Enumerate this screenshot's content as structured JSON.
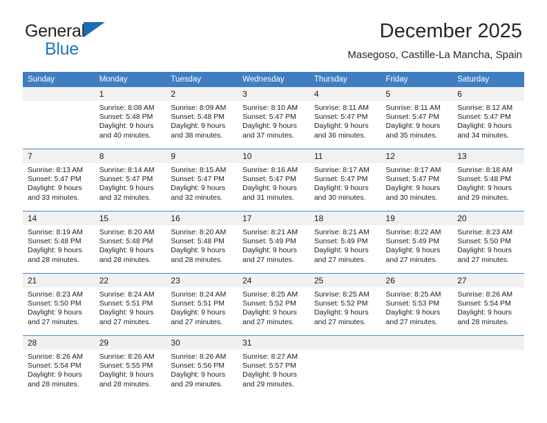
{
  "brand": {
    "name_part1": "General",
    "name_part2": "Blue",
    "triangle_color": "#1b6cb3",
    "text_color": "#231f20",
    "blue_color": "#1b75bb"
  },
  "header": {
    "title": "December 2025",
    "subtitle": "Masegoso, Castille-La Mancha, Spain"
  },
  "theme": {
    "header_bg": "#3f7fc1",
    "daynum_bg": "#f1f1f1",
    "row_divider": "#4a86c5"
  },
  "weekdays": [
    "Sunday",
    "Monday",
    "Tuesday",
    "Wednesday",
    "Thursday",
    "Friday",
    "Saturday"
  ],
  "labels": {
    "sunrise_prefix": "Sunrise:",
    "sunset_prefix": "Sunset:",
    "daylight_prefix": "Daylight:"
  },
  "weeks": [
    [
      {
        "day": "",
        "empty": true,
        "sunrise": "",
        "sunset": "",
        "daylight_line1": "",
        "daylight_line2": ""
      },
      {
        "day": "1",
        "sunrise": "Sunrise: 8:08 AM",
        "sunset": "Sunset: 5:48 PM",
        "daylight_line1": "Daylight: 9 hours",
        "daylight_line2": "and 40 minutes."
      },
      {
        "day": "2",
        "sunrise": "Sunrise: 8:09 AM",
        "sunset": "Sunset: 5:48 PM",
        "daylight_line1": "Daylight: 9 hours",
        "daylight_line2": "and 38 minutes."
      },
      {
        "day": "3",
        "sunrise": "Sunrise: 8:10 AM",
        "sunset": "Sunset: 5:47 PM",
        "daylight_line1": "Daylight: 9 hours",
        "daylight_line2": "and 37 minutes."
      },
      {
        "day": "4",
        "sunrise": "Sunrise: 8:11 AM",
        "sunset": "Sunset: 5:47 PM",
        "daylight_line1": "Daylight: 9 hours",
        "daylight_line2": "and 36 minutes."
      },
      {
        "day": "5",
        "sunrise": "Sunrise: 8:11 AM",
        "sunset": "Sunset: 5:47 PM",
        "daylight_line1": "Daylight: 9 hours",
        "daylight_line2": "and 35 minutes."
      },
      {
        "day": "6",
        "sunrise": "Sunrise: 8:12 AM",
        "sunset": "Sunset: 5:47 PM",
        "daylight_line1": "Daylight: 9 hours",
        "daylight_line2": "and 34 minutes."
      }
    ],
    [
      {
        "day": "7",
        "sunrise": "Sunrise: 8:13 AM",
        "sunset": "Sunset: 5:47 PM",
        "daylight_line1": "Daylight: 9 hours",
        "daylight_line2": "and 33 minutes."
      },
      {
        "day": "8",
        "sunrise": "Sunrise: 8:14 AM",
        "sunset": "Sunset: 5:47 PM",
        "daylight_line1": "Daylight: 9 hours",
        "daylight_line2": "and 32 minutes."
      },
      {
        "day": "9",
        "sunrise": "Sunrise: 8:15 AM",
        "sunset": "Sunset: 5:47 PM",
        "daylight_line1": "Daylight: 9 hours",
        "daylight_line2": "and 32 minutes."
      },
      {
        "day": "10",
        "sunrise": "Sunrise: 8:16 AM",
        "sunset": "Sunset: 5:47 PM",
        "daylight_line1": "Daylight: 9 hours",
        "daylight_line2": "and 31 minutes."
      },
      {
        "day": "11",
        "sunrise": "Sunrise: 8:17 AM",
        "sunset": "Sunset: 5:47 PM",
        "daylight_line1": "Daylight: 9 hours",
        "daylight_line2": "and 30 minutes."
      },
      {
        "day": "12",
        "sunrise": "Sunrise: 8:17 AM",
        "sunset": "Sunset: 5:47 PM",
        "daylight_line1": "Daylight: 9 hours",
        "daylight_line2": "and 30 minutes."
      },
      {
        "day": "13",
        "sunrise": "Sunrise: 8:18 AM",
        "sunset": "Sunset: 5:48 PM",
        "daylight_line1": "Daylight: 9 hours",
        "daylight_line2": "and 29 minutes."
      }
    ],
    [
      {
        "day": "14",
        "sunrise": "Sunrise: 8:19 AM",
        "sunset": "Sunset: 5:48 PM",
        "daylight_line1": "Daylight: 9 hours",
        "daylight_line2": "and 28 minutes."
      },
      {
        "day": "15",
        "sunrise": "Sunrise: 8:20 AM",
        "sunset": "Sunset: 5:48 PM",
        "daylight_line1": "Daylight: 9 hours",
        "daylight_line2": "and 28 minutes."
      },
      {
        "day": "16",
        "sunrise": "Sunrise: 8:20 AM",
        "sunset": "Sunset: 5:48 PM",
        "daylight_line1": "Daylight: 9 hours",
        "daylight_line2": "and 28 minutes."
      },
      {
        "day": "17",
        "sunrise": "Sunrise: 8:21 AM",
        "sunset": "Sunset: 5:49 PM",
        "daylight_line1": "Daylight: 9 hours",
        "daylight_line2": "and 27 minutes."
      },
      {
        "day": "18",
        "sunrise": "Sunrise: 8:21 AM",
        "sunset": "Sunset: 5:49 PM",
        "daylight_line1": "Daylight: 9 hours",
        "daylight_line2": "and 27 minutes."
      },
      {
        "day": "19",
        "sunrise": "Sunrise: 8:22 AM",
        "sunset": "Sunset: 5:49 PM",
        "daylight_line1": "Daylight: 9 hours",
        "daylight_line2": "and 27 minutes."
      },
      {
        "day": "20",
        "sunrise": "Sunrise: 8:23 AM",
        "sunset": "Sunset: 5:50 PM",
        "daylight_line1": "Daylight: 9 hours",
        "daylight_line2": "and 27 minutes."
      }
    ],
    [
      {
        "day": "21",
        "sunrise": "Sunrise: 8:23 AM",
        "sunset": "Sunset: 5:50 PM",
        "daylight_line1": "Daylight: 9 hours",
        "daylight_line2": "and 27 minutes."
      },
      {
        "day": "22",
        "sunrise": "Sunrise: 8:24 AM",
        "sunset": "Sunset: 5:51 PM",
        "daylight_line1": "Daylight: 9 hours",
        "daylight_line2": "and 27 minutes."
      },
      {
        "day": "23",
        "sunrise": "Sunrise: 8:24 AM",
        "sunset": "Sunset: 5:51 PM",
        "daylight_line1": "Daylight: 9 hours",
        "daylight_line2": "and 27 minutes."
      },
      {
        "day": "24",
        "sunrise": "Sunrise: 8:25 AM",
        "sunset": "Sunset: 5:52 PM",
        "daylight_line1": "Daylight: 9 hours",
        "daylight_line2": "and 27 minutes."
      },
      {
        "day": "25",
        "sunrise": "Sunrise: 8:25 AM",
        "sunset": "Sunset: 5:52 PM",
        "daylight_line1": "Daylight: 9 hours",
        "daylight_line2": "and 27 minutes."
      },
      {
        "day": "26",
        "sunrise": "Sunrise: 8:25 AM",
        "sunset": "Sunset: 5:53 PM",
        "daylight_line1": "Daylight: 9 hours",
        "daylight_line2": "and 27 minutes."
      },
      {
        "day": "27",
        "sunrise": "Sunrise: 8:26 AM",
        "sunset": "Sunset: 5:54 PM",
        "daylight_line1": "Daylight: 9 hours",
        "daylight_line2": "and 28 minutes."
      }
    ],
    [
      {
        "day": "28",
        "sunrise": "Sunrise: 8:26 AM",
        "sunset": "Sunset: 5:54 PM",
        "daylight_line1": "Daylight: 9 hours",
        "daylight_line2": "and 28 minutes."
      },
      {
        "day": "29",
        "sunrise": "Sunrise: 8:26 AM",
        "sunset": "Sunset: 5:55 PM",
        "daylight_line1": "Daylight: 9 hours",
        "daylight_line2": "and 28 minutes."
      },
      {
        "day": "30",
        "sunrise": "Sunrise: 8:26 AM",
        "sunset": "Sunset: 5:56 PM",
        "daylight_line1": "Daylight: 9 hours",
        "daylight_line2": "and 29 minutes."
      },
      {
        "day": "31",
        "sunrise": "Sunrise: 8:27 AM",
        "sunset": "Sunset: 5:57 PM",
        "daylight_line1": "Daylight: 9 hours",
        "daylight_line2": "and 29 minutes."
      },
      {
        "day": "",
        "empty": true,
        "sunrise": "",
        "sunset": "",
        "daylight_line1": "",
        "daylight_line2": ""
      },
      {
        "day": "",
        "empty": true,
        "sunrise": "",
        "sunset": "",
        "daylight_line1": "",
        "daylight_line2": ""
      },
      {
        "day": "",
        "empty": true,
        "sunrise": "",
        "sunset": "",
        "daylight_line1": "",
        "daylight_line2": ""
      }
    ]
  ]
}
